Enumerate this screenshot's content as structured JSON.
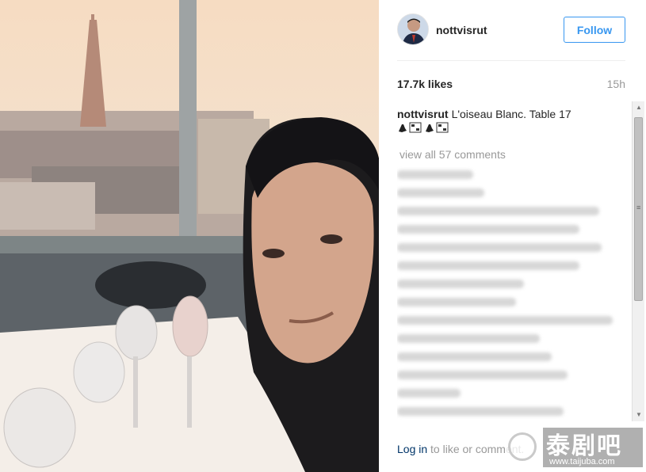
{
  "post": {
    "username": "nottvisrut",
    "follow_label": "Follow",
    "likes": "17.7k likes",
    "time": "15h",
    "caption_user": "nottvisrut",
    "caption_text": "L'oiseau Blanc. Table 17",
    "view_all_comments": "view all 57 comments"
  },
  "footer": {
    "login_label": "Log in",
    "rest": " to like or comment."
  },
  "watermark": {
    "title": "泰剧吧",
    "url": "www.taijuba.com"
  },
  "colors": {
    "accent": "#3897f0",
    "username": "#262626",
    "muted": "#999999",
    "link": "#003569"
  },
  "icons": [
    "avatar",
    "emoji-icon",
    "scroll-up-icon",
    "scroll-down-icon",
    "watermark-logo-icon"
  ]
}
